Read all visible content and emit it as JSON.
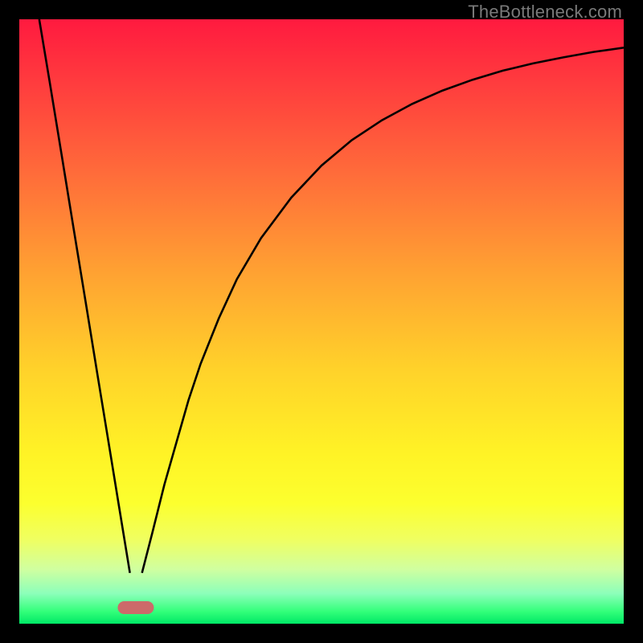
{
  "watermark": "TheBottleneck.com",
  "colors": {
    "background": "#000000",
    "curve": "#000000",
    "marker": "#cc6a6a",
    "gradient_top": "#ff1a3f",
    "gradient_bottom": "#00e866"
  },
  "chart_data": {
    "type": "line",
    "title": "",
    "xlabel": "",
    "ylabel": "",
    "xlim": [
      0,
      100
    ],
    "ylim": [
      0,
      100
    ],
    "grid": false,
    "legend": false,
    "series": [
      {
        "name": "left",
        "x": [
          3.3,
          5.0,
          7.0,
          9.0,
          11.0,
          13.0,
          15.0,
          16.5,
          17.5,
          18.3
        ],
        "values": [
          100,
          89.8,
          77.6,
          65.3,
          53.1,
          40.8,
          28.6,
          19.4,
          13.3,
          8.4
        ]
      },
      {
        "name": "right",
        "x": [
          20.3,
          22,
          24,
          26,
          28,
          30,
          33,
          36,
          40,
          45,
          50,
          55,
          60,
          65,
          70,
          75,
          80,
          85,
          90,
          95,
          100
        ],
        "values": [
          8.4,
          15,
          23,
          30,
          37,
          43,
          50.5,
          57,
          63.8,
          70.5,
          75.8,
          80,
          83.3,
          86,
          88.2,
          90,
          91.5,
          92.7,
          93.7,
          94.6,
          95.3
        ]
      }
    ],
    "marker": {
      "x": 19.3,
      "y": 2.6,
      "width_x_units": 6
    }
  }
}
